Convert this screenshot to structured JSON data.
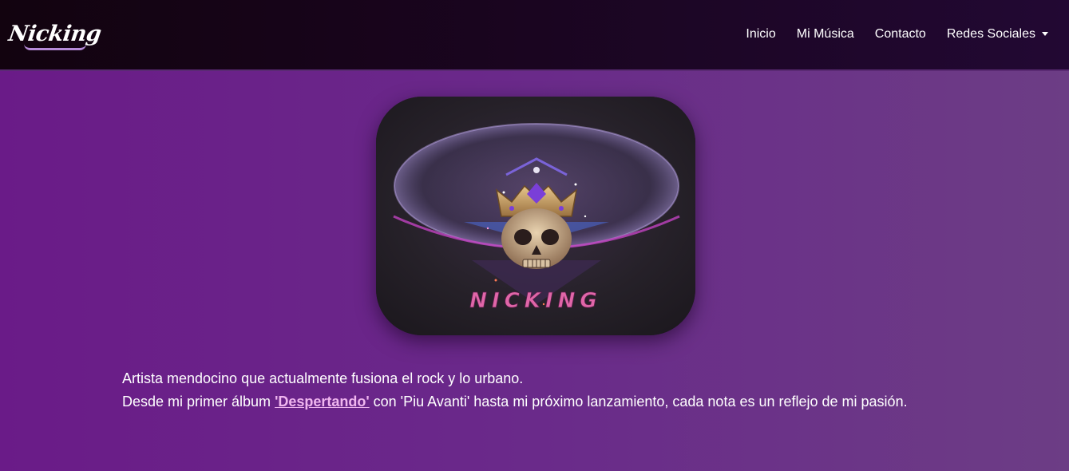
{
  "navbar": {
    "brand": "Nicking",
    "links": [
      {
        "label": "Inicio"
      },
      {
        "label": "Mi Música"
      },
      {
        "label": "Contacto"
      },
      {
        "label": "Redes Sociales"
      }
    ]
  },
  "cover": {
    "logo_text": "NICKING",
    "icon": "crowned-skull-icon"
  },
  "about": {
    "line1": "Artista mendocino que actualmente fusiona el rock y lo urbano.",
    "line2_before": "Desde mi primer álbum ",
    "album_link": "'Despertando'",
    "line2_after": " con 'Piu Avanti' hasta mi próximo lanzamiento, cada nota es un reflejo de mi pasión."
  },
  "colors": {
    "background": "#6a1b88",
    "navbar": "#1a0520",
    "link_accent": "#f0b6ef",
    "logo_pink": "#e066a8"
  }
}
